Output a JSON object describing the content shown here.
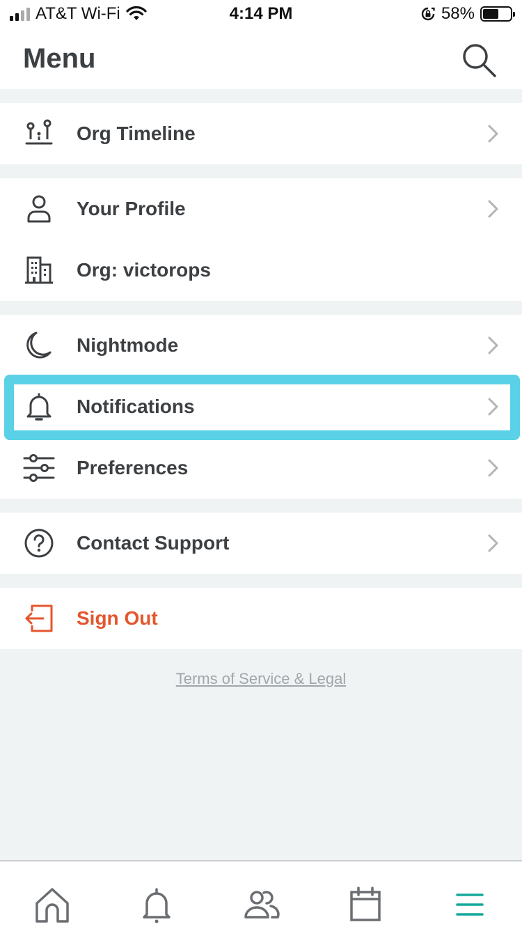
{
  "status_bar": {
    "carrier": "AT&T Wi-Fi",
    "time": "4:14 PM",
    "battery_percent": "58%",
    "battery_level": 0.58
  },
  "header": {
    "title": "Menu",
    "search_icon": "search-icon"
  },
  "menu": {
    "org_timeline": {
      "label": "Org Timeline",
      "icon": "timeline-icon"
    },
    "your_profile": {
      "label": "Your Profile",
      "icon": "person-icon"
    },
    "org": {
      "label": "Org: victorops",
      "icon": "building-icon"
    },
    "nightmode": {
      "label": "Nightmode",
      "icon": "moon-icon"
    },
    "notifications": {
      "label": "Notifications",
      "icon": "bell-icon"
    },
    "preferences": {
      "label": "Preferences",
      "icon": "sliders-icon"
    },
    "contact_support": {
      "label": "Contact Support",
      "icon": "help-circle-icon"
    },
    "sign_out": {
      "label": "Sign Out",
      "icon": "sign-out-icon"
    }
  },
  "terms_link": "Terms of Service & Legal",
  "tab_bar": [
    "home-icon",
    "bell-icon",
    "users-icon",
    "calendar-icon",
    "menu-icon"
  ],
  "colors": {
    "text": "#3d4043",
    "sign_out": "#e4562d",
    "highlight": "#5ad1e6",
    "active_tab": "#15a89b",
    "background": "#eff3f4"
  }
}
